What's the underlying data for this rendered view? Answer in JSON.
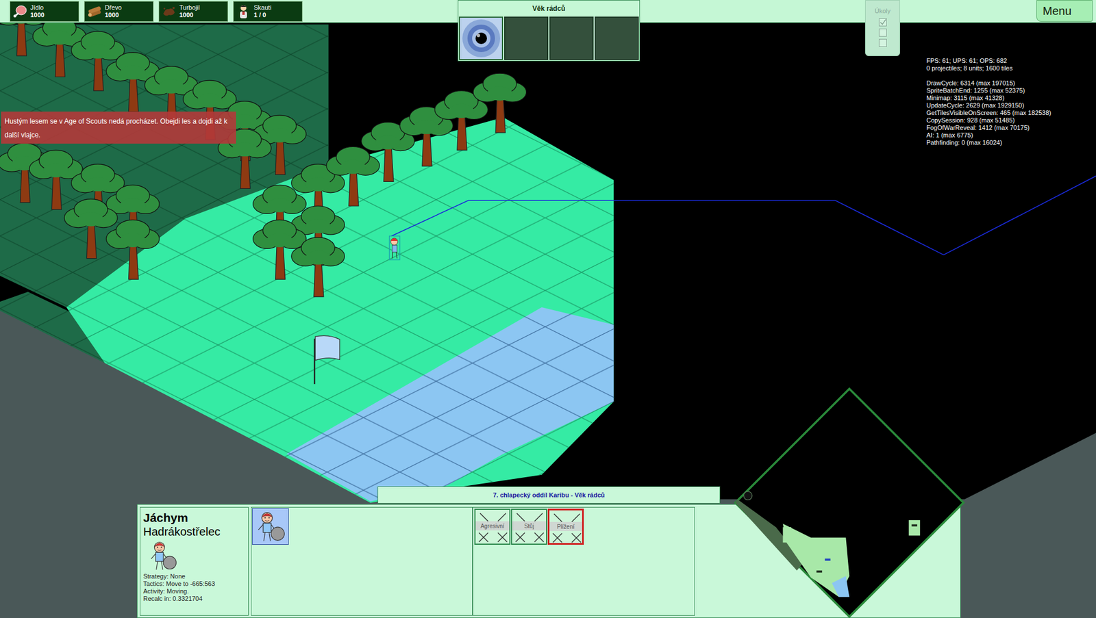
{
  "resources": [
    {
      "name": "Jídlo",
      "value": "1000"
    },
    {
      "name": "Dřevo",
      "value": "1000"
    },
    {
      "name": "Turbojil",
      "value": "1000"
    },
    {
      "name": "Skauti",
      "value": "1 / 0"
    }
  ],
  "age_panel": {
    "title": "Věk rádců",
    "slots": [
      {
        "filled": true
      },
      {
        "filled": false
      },
      {
        "filled": false
      },
      {
        "filled": false
      }
    ]
  },
  "tasks": {
    "title": "Úkoly",
    "items": [
      {
        "checked": true
      },
      {
        "checked": false
      },
      {
        "checked": false
      }
    ]
  },
  "menu_button": "Menu",
  "debug": {
    "stats": [
      "FPS: 61; UPS: 61; OPS: 682",
      "0 projectiles; 8 units; 1600 tiles"
    ],
    "timings": [
      "DrawCycle: 6314 (max 197015)",
      "SpriteBatchEnd: 1255 (max 52375)",
      "Minimap: 3115 (max 41328)",
      "UpdateCycle: 2629 (max 1929150)",
      "GetTilesVisibleOnScreen: 465 (max 182538)",
      "CopySession: 928 (max 51485)",
      "FogOfWarReveal: 1412 (max 70175)",
      "AI: 1 (max 6775)",
      "Pathfinding: 0 (max 16024)"
    ]
  },
  "tooltip": "Hustým lesem se v Age of Scouts nedá procházet. Obejdi les a dojdi až k další vlajce.",
  "unit_panel": {
    "title": "7. chlapecký oddíl Karibu - Věk rádců",
    "unit": {
      "name": "Jáchym",
      "class": "Hadrákostřelec",
      "details": [
        "Strategy: None",
        "Tactics: Move to -665:563",
        "Activity: Moving.",
        "Recalc in: 0.3321704"
      ]
    },
    "stances": [
      {
        "label": "Agresivní",
        "selected": false
      },
      {
        "label": "Stůj",
        "selected": false
      },
      {
        "label": "Plížení",
        "selected": true
      }
    ]
  }
}
